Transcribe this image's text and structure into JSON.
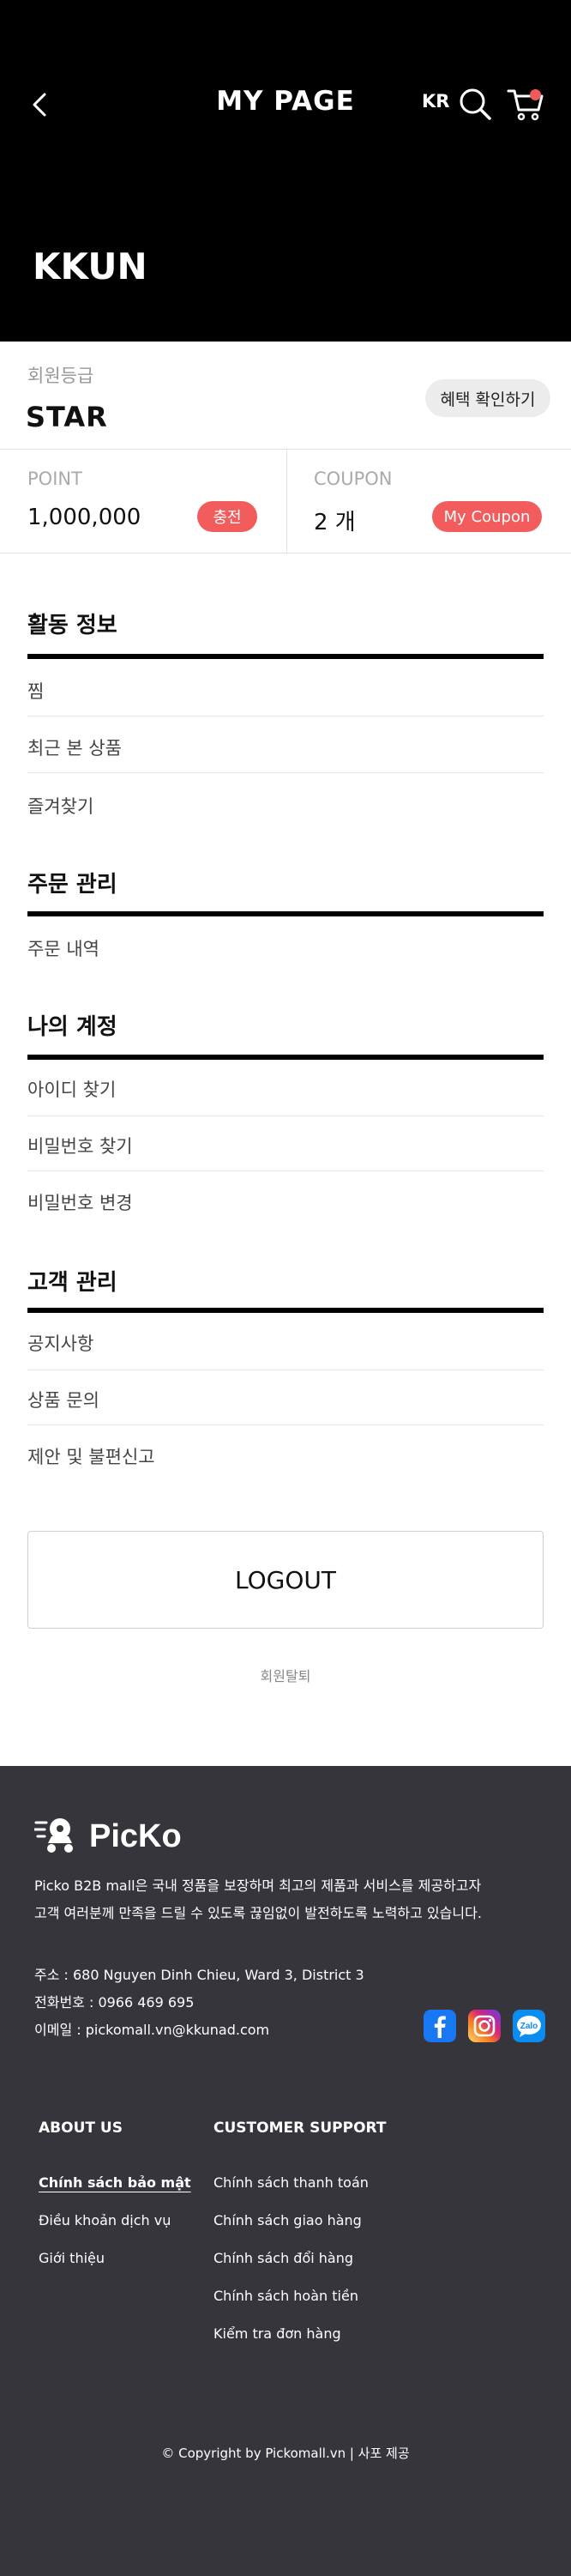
{
  "header": {
    "title": "MY PAGE",
    "lang": "KR",
    "username": "KKUN",
    "cart_badge_color": "#f05a5a"
  },
  "grade": {
    "label": "회원등급",
    "value": "STAR",
    "benefit_button": "혜택 확인하기"
  },
  "point": {
    "label": "POINT",
    "value": "1,000,000",
    "button": "충전"
  },
  "coupon": {
    "label": "COUPON",
    "value": "2 개",
    "button": "My Coupon"
  },
  "sections": [
    {
      "title": "활동 정보",
      "items": [
        "찜",
        "최근 본 상품",
        "즐겨찾기"
      ]
    },
    {
      "title": "주문 관리",
      "items": [
        "주문 내역"
      ]
    },
    {
      "title": "나의 계정",
      "items": [
        "아이디 찾기",
        "비밀번호 찾기",
        "비밀번호 변경"
      ]
    },
    {
      "title": "고객 관리",
      "items": [
        "공지사항",
        "상품 문의",
        "제안 및 불편신고"
      ]
    }
  ],
  "logout_label": "LOGOUT",
  "withdraw_label": "회원탈퇴",
  "footer": {
    "brand": "PicKo",
    "description_line1": "Picko B2B mall은 국내 정품을 보장하며 최고의 제품과 서비스를 제공하고자",
    "description_line2": "고객 여러분께 만족을 드릴 수 있도록 끊임없이 발전하도록 노력하고 있습니다.",
    "address": "주소 : 680 Nguyen Dinh Chieu, Ward 3, District 3",
    "phone": "전화번호 : 0966 469 695",
    "email": "이메일 : pickomall.vn@kkunad.com",
    "social_icons": [
      "facebook-icon",
      "instagram-icon",
      "zalo-icon"
    ],
    "zalo_label": "Zalo",
    "about_heading": "ABOUT US",
    "about_links": [
      "Chính sách bảo mật",
      "Điều khoản dịch vụ",
      "Giới thiệu"
    ],
    "support_heading": "CUSTOMER SUPPORT",
    "support_links": [
      "Chính sách thanh toán",
      "Chính sách giao hàng",
      "Chính sách đổi hàng",
      "Chính sách hoàn tiền",
      "Kiểm tra đơn hàng"
    ],
    "copyright": "© Copyright by Pickomall.vn | 사포 제공"
  },
  "colors": {
    "accent": "#f25c5c",
    "footer_bg": "#36353c",
    "header_bg": "#000000"
  }
}
